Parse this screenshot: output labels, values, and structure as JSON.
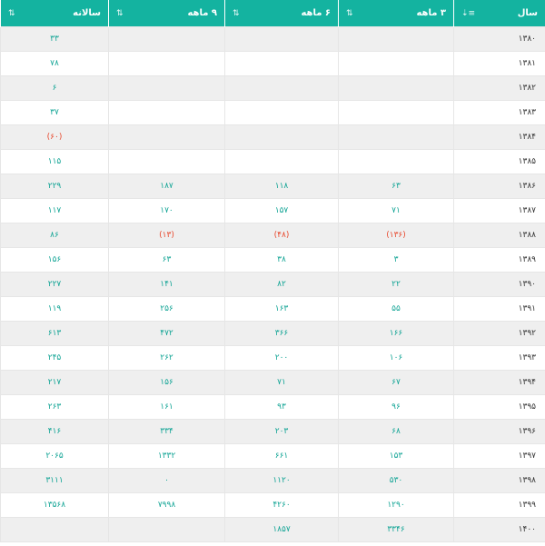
{
  "columns": [
    "سال",
    "۳ ماهه",
    "۶ ماهه",
    "۹ ماهه",
    "سالانه"
  ],
  "sort_icon_year": "⇣≡",
  "sort_icon": "⇅",
  "colors": {
    "header": "#14b3a0",
    "value": "#14a596",
    "negative": "#e84a2f"
  },
  "rows": [
    {
      "year": "۱۳۸۰",
      "q3": "",
      "q6": "",
      "q9": "",
      "annual": "۳۳"
    },
    {
      "year": "۱۳۸۱",
      "q3": "",
      "q6": "",
      "q9": "",
      "annual": "۷۸"
    },
    {
      "year": "۱۳۸۲",
      "q3": "",
      "q6": "",
      "q9": "",
      "annual": "۶"
    },
    {
      "year": "۱۳۸۳",
      "q3": "",
      "q6": "",
      "q9": "",
      "annual": "۳۷"
    },
    {
      "year": "۱۳۸۴",
      "q3": "",
      "q6": "",
      "q9": "",
      "annual": "(۶۰)"
    },
    {
      "year": "۱۳۸۵",
      "q3": "",
      "q6": "",
      "q9": "",
      "annual": "۱۱۵"
    },
    {
      "year": "۱۳۸۶",
      "q3": "۶۳",
      "q6": "۱۱۸",
      "q9": "۱۸۷",
      "annual": "۲۲۹"
    },
    {
      "year": "۱۳۸۷",
      "q3": "۷۱",
      "q6": "۱۵۷",
      "q9": "۱۷۰",
      "annual": "۱۱۷"
    },
    {
      "year": "۱۳۸۸",
      "q3": "(۱۳۶)",
      "q6": "(۴۸)",
      "q9": "(۱۳)",
      "annual": "۸۶"
    },
    {
      "year": "۱۳۸۹",
      "q3": "۳",
      "q6": "۳۸",
      "q9": "۶۳",
      "annual": "۱۵۶"
    },
    {
      "year": "۱۳۹۰",
      "q3": "۲۲",
      "q6": "۸۲",
      "q9": "۱۴۱",
      "annual": "۲۲۷"
    },
    {
      "year": "۱۳۹۱",
      "q3": "۵۵",
      "q6": "۱۶۳",
      "q9": "۲۵۶",
      "annual": "۱۱۹"
    },
    {
      "year": "۱۳۹۲",
      "q3": "۱۶۶",
      "q6": "۳۶۶",
      "q9": "۴۷۲",
      "annual": "۶۱۳"
    },
    {
      "year": "۱۳۹۳",
      "q3": "۱۰۶",
      "q6": "۲۰۰",
      "q9": "۲۶۲",
      "annual": "۲۴۵"
    },
    {
      "year": "۱۳۹۴",
      "q3": "۶۷",
      "q6": "۷۱",
      "q9": "۱۵۶",
      "annual": "۲۱۷"
    },
    {
      "year": "۱۳۹۵",
      "q3": "۹۶",
      "q6": "۹۳",
      "q9": "۱۶۱",
      "annual": "۲۶۳"
    },
    {
      "year": "۱۳۹۶",
      "q3": "۶۸",
      "q6": "۲۰۳",
      "q9": "۳۳۴",
      "annual": "۴۱۶"
    },
    {
      "year": "۱۳۹۷",
      "q3": "۱۵۳",
      "q6": "۶۶۱",
      "q9": "۱۳۳۲",
      "annual": "۲۰۶۵"
    },
    {
      "year": "۱۳۹۸",
      "q3": "۵۳۰",
      "q6": "۱۱۲۰",
      "q9": "۰",
      "annual": "۳۱۱۱"
    },
    {
      "year": "۱۳۹۹",
      "q3": "۱۲۹۰",
      "q6": "۴۲۶۰",
      "q9": "۷۹۹۸",
      "annual": "۱۳۵۶۸"
    },
    {
      "year": "۱۴۰۰",
      "q3": "۳۳۴۶",
      "q6": "۱۸۵۷",
      "q9": "",
      "annual": ""
    }
  ]
}
